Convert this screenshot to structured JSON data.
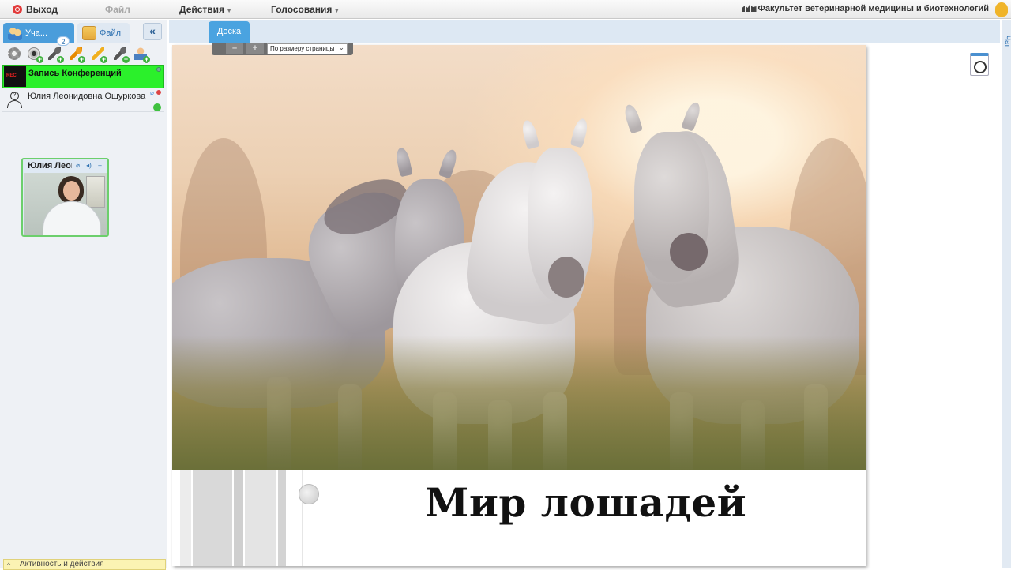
{
  "topbar": {
    "exit_label": "Выход",
    "file_menu": "Файл",
    "actions_menu": "Действия",
    "polls_menu": "Голосования",
    "org_title": "Факультет ветеринарной медицины и биотехнологий"
  },
  "left_panel": {
    "tabs": [
      {
        "label": "Уча...",
        "badge": "2"
      },
      {
        "label": "Файл"
      }
    ],
    "collapse_label": "«",
    "users": [
      {
        "name": "Запись Конференций",
        "highlight_color": "#2bf02b"
      },
      {
        "name": "Юлия Леонидовна Ошуркова"
      }
    ],
    "video": {
      "title": "Юлия Леонидовна Ошуркова",
      "ctrl_audio": "⌀",
      "ctrl_sound": "◂)",
      "ctrl_minimize": "–"
    },
    "activity_label": "Активность и действия"
  },
  "board": {
    "tab_label": "Доска",
    "zoom": {
      "minus": "–",
      "plus": "+",
      "fit_option": "По размеру страницы"
    },
    "slide_title": "Мир лошадей"
  },
  "right_strip": {
    "label": "Чат"
  },
  "colors": {
    "accent": "#4a9ddb",
    "status_online": "#3fc13f"
  }
}
